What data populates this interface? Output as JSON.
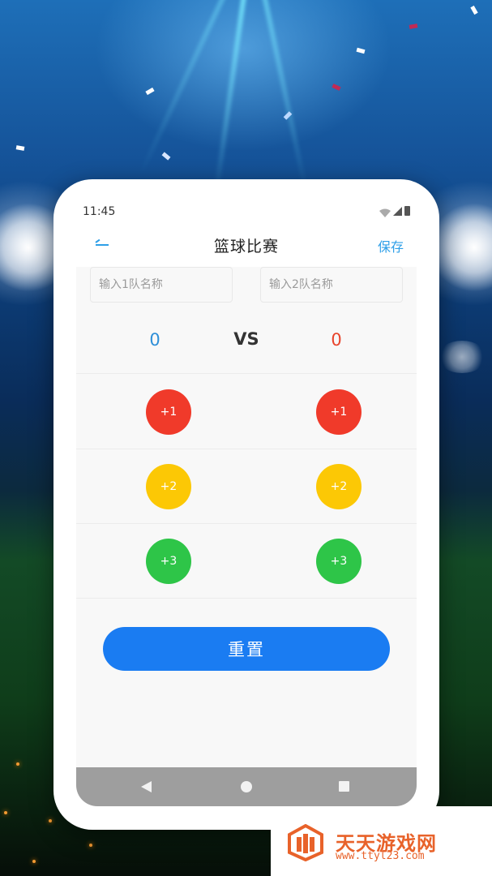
{
  "status_bar": {
    "time": "11:45"
  },
  "app_bar": {
    "title": "篮球比赛",
    "save_label": "保存"
  },
  "inputs": {
    "team1_placeholder": "输入1队名称",
    "team2_placeholder": "输入2队名称"
  },
  "scoreboard": {
    "team1_score": "0",
    "vs_label": "VS",
    "team2_score": "0"
  },
  "buttons": {
    "plus1": "+1",
    "plus2": "+2",
    "plus3": "+3",
    "reset_label": "重置"
  },
  "icons": [
    "back-arrow-icon",
    "wifi-icon",
    "signal-icon",
    "battery-icon",
    "nav-back-icon",
    "nav-home-icon",
    "nav-recent-icon"
  ],
  "colors": {
    "accent_blue": "#1a7cf2",
    "team1_score": "#2e8fd8",
    "team2_score": "#e8442c",
    "plus1_red": "#f03a2a",
    "plus2_yellow": "#fcc805",
    "plus3_green": "#2ec548"
  },
  "watermark": {
    "title": "天天游戏网",
    "url": "www.ttyl23.com"
  }
}
